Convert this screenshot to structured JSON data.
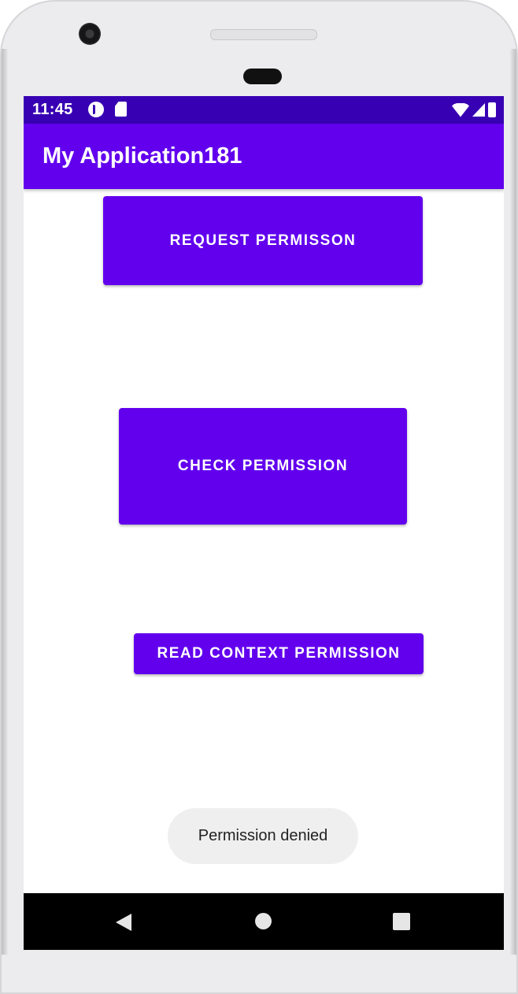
{
  "status_bar": {
    "time": "11:45",
    "icons": [
      "notification-p-icon",
      "sd-card-icon",
      "wifi-icon",
      "cell-signal-icon",
      "battery-icon"
    ]
  },
  "app_bar": {
    "title": "My Application181"
  },
  "buttons": {
    "request_permission": "REQUEST PERMISSON",
    "check_permission": "CHECK PERMISSION",
    "read_context_permission": "READ CONTEXT PERMISSION"
  },
  "toast": {
    "message": "Permission denied"
  },
  "navigation": {
    "icons": [
      "back-icon",
      "home-icon",
      "recents-icon"
    ]
  },
  "colors": {
    "status_bar": "#3700b3",
    "primary": "#6200ee",
    "nav_bar": "#000000",
    "toast_bg": "#efefef"
  }
}
